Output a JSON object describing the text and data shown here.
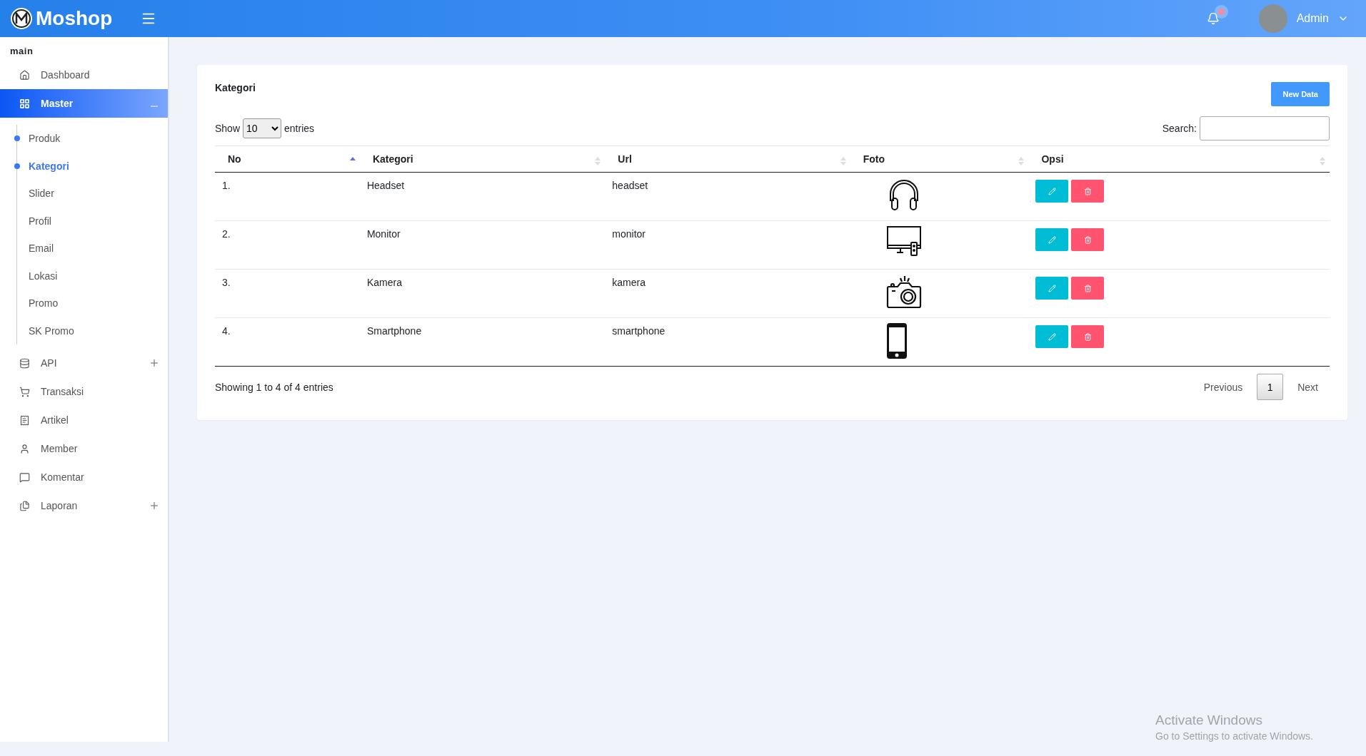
{
  "header": {
    "brand": "Moshop",
    "notification": {
      "unread": true
    },
    "user": {
      "name": "Admin"
    }
  },
  "sidebar": {
    "section": "main",
    "items": [
      {
        "label": "Dashboard",
        "selected": false
      },
      {
        "label": "Master",
        "selected": true,
        "expanded": true,
        "children": [
          {
            "label": "Produk",
            "selected": false,
            "dot": true
          },
          {
            "label": "Kategori",
            "selected": true,
            "dot": true
          },
          {
            "label": "Slider",
            "selected": false,
            "dot": false
          },
          {
            "label": "Profil",
            "selected": false,
            "dot": false
          },
          {
            "label": "Email",
            "selected": false,
            "dot": false
          },
          {
            "label": "Lokasi",
            "selected": false,
            "dot": false
          },
          {
            "label": "Promo",
            "selected": false,
            "dot": false
          },
          {
            "label": "SK Promo",
            "selected": false,
            "dot": false
          }
        ]
      },
      {
        "label": "API",
        "selected": false,
        "expanded": false
      },
      {
        "label": "Transaksi",
        "selected": false
      },
      {
        "label": "Artikel",
        "selected": false
      },
      {
        "label": "Member",
        "selected": false
      },
      {
        "label": "Komentar",
        "selected": false
      },
      {
        "label": "Laporan",
        "selected": false,
        "expanded": false
      }
    ]
  },
  "card": {
    "title": "Kategori",
    "new_button": "New Data",
    "show_label": "Show",
    "page_size": "10",
    "entries_label": "entries",
    "search_label": "Search:",
    "columns": [
      {
        "label": "No",
        "sorted": true
      },
      {
        "label": "Kategori",
        "sorted": false
      },
      {
        "label": "Url",
        "sorted": false
      },
      {
        "label": "Foto",
        "sorted": false
      },
      {
        "label": "Opsi",
        "sorted": false
      }
    ],
    "rows": [
      {
        "no": "1.",
        "kategori": "Headset",
        "url": "headset"
      },
      {
        "no": "2.",
        "kategori": "Monitor",
        "url": "monitor"
      },
      {
        "no": "3.",
        "kategori": "Kamera",
        "url": "kamera"
      },
      {
        "no": "4.",
        "kategori": "Smartphone",
        "url": "smartphone"
      }
    ],
    "info": "Showing 1 to 4 of 4 entries",
    "pagination": {
      "previous": "Previous",
      "pages": [
        {
          "label": "1",
          "selected": true
        }
      ],
      "next": "Next"
    }
  },
  "os_notice": {
    "title": "Activate Windows",
    "text": "Go to Settings to activate Windows."
  }
}
